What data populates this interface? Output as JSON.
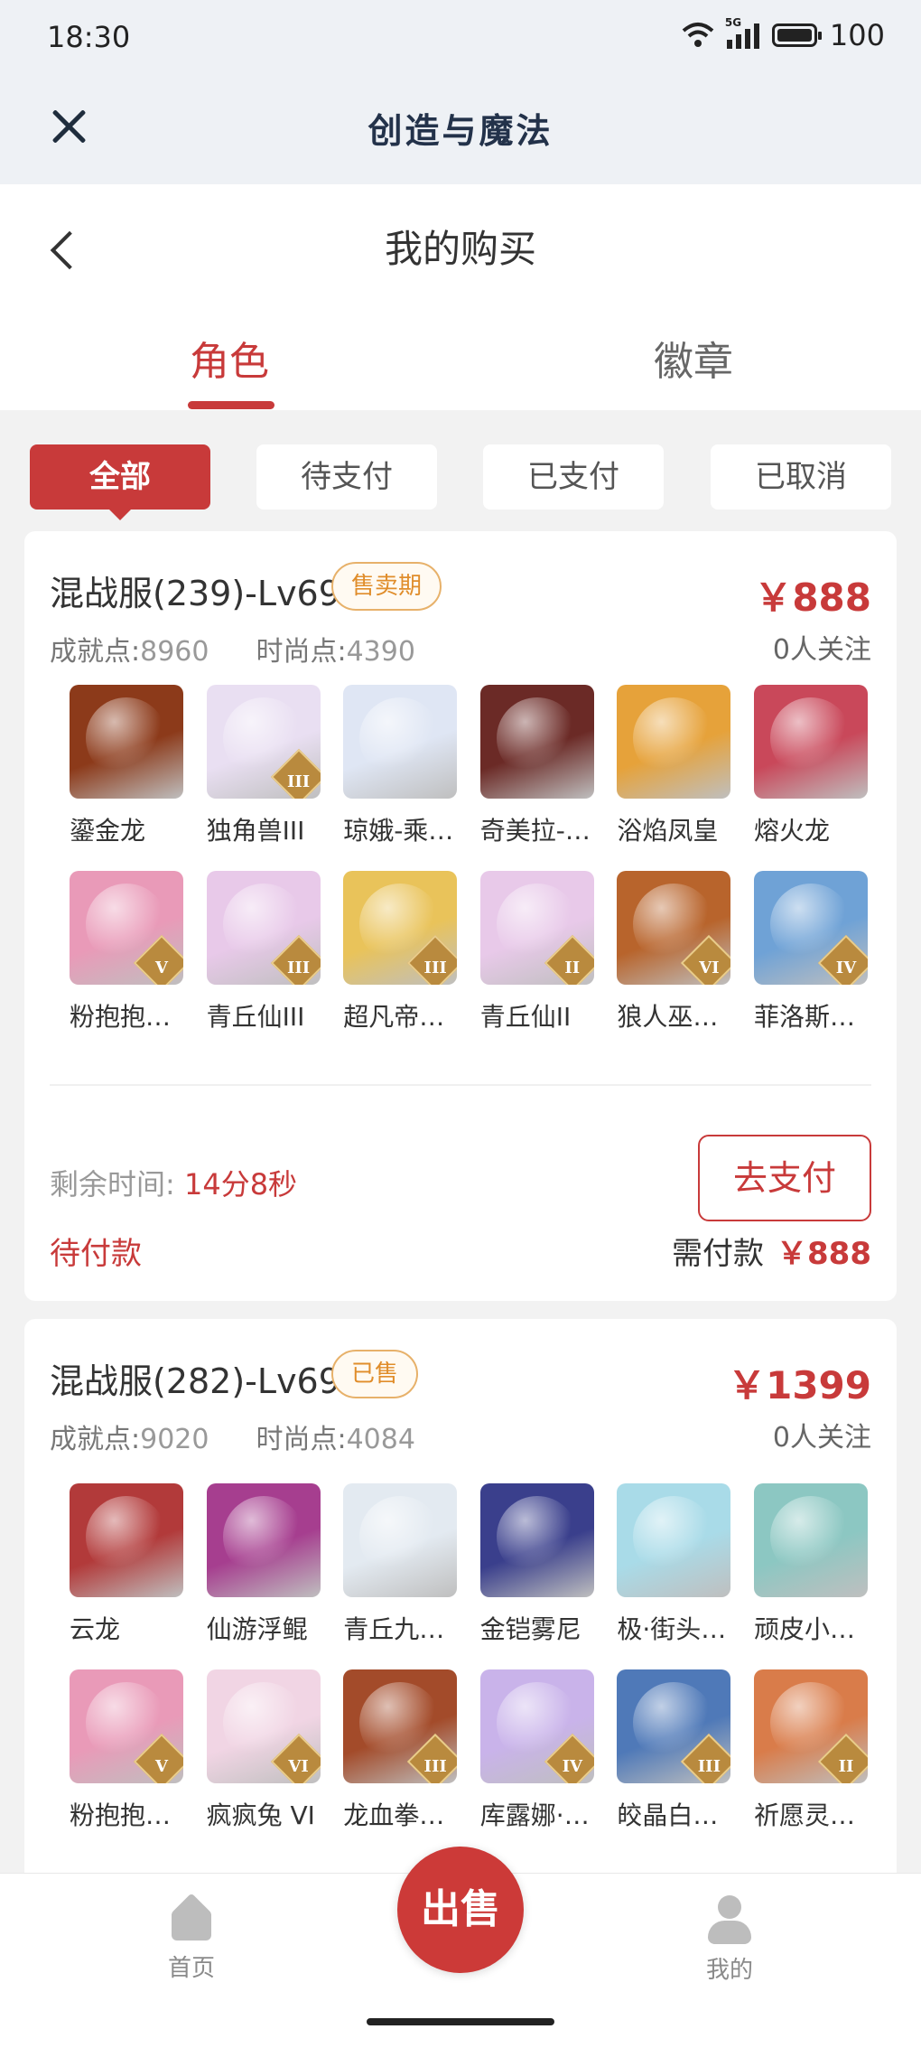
{
  "status_bar": {
    "time": "18:30",
    "network": "5G",
    "battery": "100"
  },
  "app": {
    "title": "创造与魔法"
  },
  "page": {
    "title": "我的购买",
    "tabs": [
      {
        "label": "角色",
        "active": true
      },
      {
        "label": "徽章",
        "active": false
      }
    ]
  },
  "filters": [
    {
      "label": "全部",
      "active": true
    },
    {
      "label": "待支付",
      "active": false
    },
    {
      "label": "已支付",
      "active": false
    },
    {
      "label": "已取消",
      "active": false
    }
  ],
  "orders": [
    {
      "server": "混战服(239)-Lv69",
      "tag": "售卖期",
      "price": "￥888",
      "achievement_label": "成就点:",
      "achievement": "8960",
      "fashion_label": "时尚点:",
      "fashion": "4390",
      "follows": "0人关注",
      "items": [
        {
          "name": "鎏金龙",
          "color": "#8c3a1a",
          "rank": ""
        },
        {
          "name": "独角兽III",
          "color": "#e9dff2",
          "rank": "III"
        },
        {
          "name": "琼娥-乘…",
          "color": "#dfe6f4",
          "rank": ""
        },
        {
          "name": "奇美拉-…",
          "color": "#6b2a26",
          "rank": ""
        },
        {
          "name": "浴焰凤皇",
          "color": "#e6a23a",
          "rank": ""
        },
        {
          "name": "熔火龙",
          "color": "#c9485a",
          "rank": ""
        },
        {
          "name": "粉抱抱…",
          "color": "#e99ab8",
          "rank": "V"
        },
        {
          "name": "青丘仙III",
          "color": "#e8c9e9",
          "rank": "III"
        },
        {
          "name": "超凡帝…",
          "color": "#e9c35a",
          "rank": "III"
        },
        {
          "name": "青丘仙II",
          "color": "#e8c9e9",
          "rank": "II"
        },
        {
          "name": "狼人巫…",
          "color": "#b8642c",
          "rank": "VI"
        },
        {
          "name": "菲洛斯…",
          "color": "#6fa2d6",
          "rank": "IV"
        }
      ],
      "remain_label": "剩余时间:",
      "remain_value": "14分8秒",
      "status": "待付款",
      "pay_button": "去支付",
      "need_pay_label": "需付款",
      "need_pay_amount": "￥888"
    },
    {
      "server": "混战服(282)-Lv69",
      "tag": "已售",
      "price": "￥1399",
      "achievement_label": "成就点:",
      "achievement": "9020",
      "fashion_label": "时尚点:",
      "fashion": "4084",
      "follows": "0人关注",
      "items": [
        {
          "name": "云龙",
          "color": "#b23a3a",
          "rank": ""
        },
        {
          "name": "仙游浮鲲",
          "color": "#a63e8f",
          "rank": ""
        },
        {
          "name": "青丘九…",
          "color": "#e3eaf1",
          "rank": ""
        },
        {
          "name": "金铠雾尼",
          "color": "#3a3f8c",
          "rank": ""
        },
        {
          "name": "极·街头…",
          "color": "#a9dbe8",
          "rank": ""
        },
        {
          "name": "顽皮小…",
          "color": "#8cc7c2",
          "rank": ""
        },
        {
          "name": "粉抱抱…",
          "color": "#e99ab8",
          "rank": "V"
        },
        {
          "name": "疯疯兔 VI",
          "color": "#f1d5e4",
          "rank": "VI"
        },
        {
          "name": "龙血拳…",
          "color": "#a34b2a",
          "rank": "III"
        },
        {
          "name": "库露娜·…",
          "color": "#c9b3ea",
          "rank": "IV"
        },
        {
          "name": "皎晶白…",
          "color": "#4f79b8",
          "rank": "III"
        },
        {
          "name": "祈愿灵…",
          "color": "#d97c4a",
          "rank": "II"
        }
      ]
    }
  ],
  "bottom_nav": {
    "home": "首页",
    "sell": "出售",
    "mine": "我的"
  }
}
